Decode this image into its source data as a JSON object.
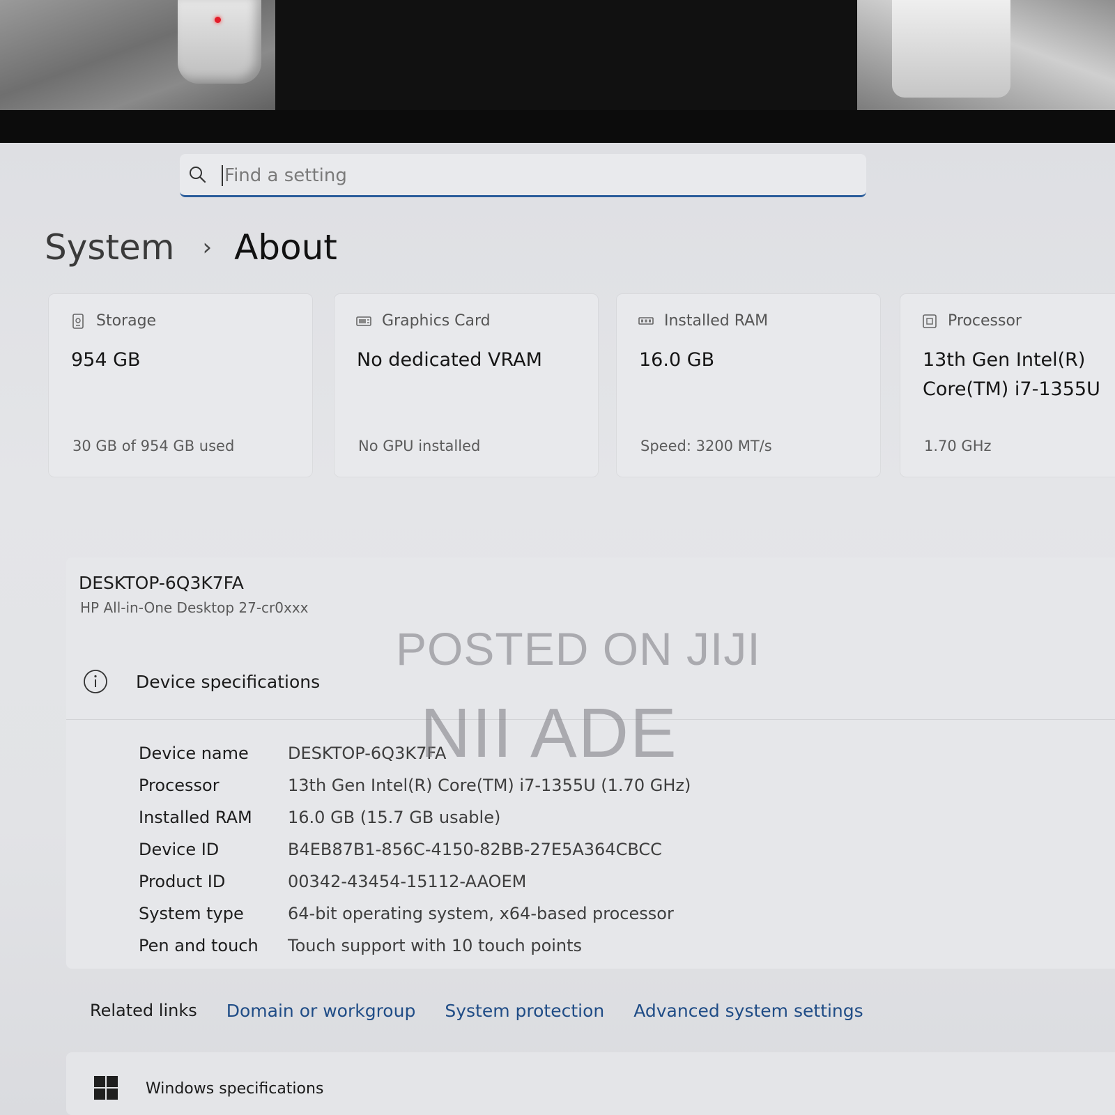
{
  "search": {
    "placeholder": "Find a setting"
  },
  "breadcrumb": {
    "parent": "System",
    "current": "About"
  },
  "cards": [
    {
      "icon": "storage-icon",
      "label": "Storage",
      "value": "954 GB",
      "sub": "30 GB of 954 GB used"
    },
    {
      "icon": "graphics-card-icon",
      "label": "Graphics Card",
      "value": "No dedicated VRAM",
      "sub": "No GPU installed"
    },
    {
      "icon": "ram-icon",
      "label": "Installed RAM",
      "value": "16.0 GB",
      "sub": "Speed: 3200 MT/s"
    },
    {
      "icon": "processor-icon",
      "label": "Processor",
      "value": "13th Gen Intel(R)\nCore(TM) i7-1355U",
      "sub": "1.70 GHz"
    }
  ],
  "device": {
    "hostname": "DESKTOP-6Q3K7FA",
    "model": "HP All-in-One Desktop 27-cr0xxx"
  },
  "specs": {
    "title": "Device specifications",
    "rows": [
      {
        "key": "Device name",
        "value": "DESKTOP-6Q3K7FA"
      },
      {
        "key": "Processor",
        "value": "13th Gen Intel(R) Core(TM) i7-1355U (1.70 GHz)"
      },
      {
        "key": "Installed RAM",
        "value": "16.0 GB (15.7 GB usable)"
      },
      {
        "key": "Device ID",
        "value": "B4EB87B1-856C-4150-82BB-27E5A364CBCC"
      },
      {
        "key": "Product ID",
        "value": "00342-43454-15112-AAOEM"
      },
      {
        "key": "System type",
        "value": "64-bit operating system, x64-based processor"
      },
      {
        "key": "Pen and touch",
        "value": "Touch support with 10 touch points"
      }
    ]
  },
  "related": {
    "title": "Related links",
    "links": [
      "Domain or workgroup",
      "System protection",
      "Advanced system settings"
    ]
  },
  "windows_spec": {
    "title": "Windows specifications"
  },
  "watermark": {
    "line1": "POSTED ON JIJI",
    "line2": "NII ADE"
  },
  "colors": {
    "accent": "#2b5d9b",
    "link": "#1f4c86"
  }
}
